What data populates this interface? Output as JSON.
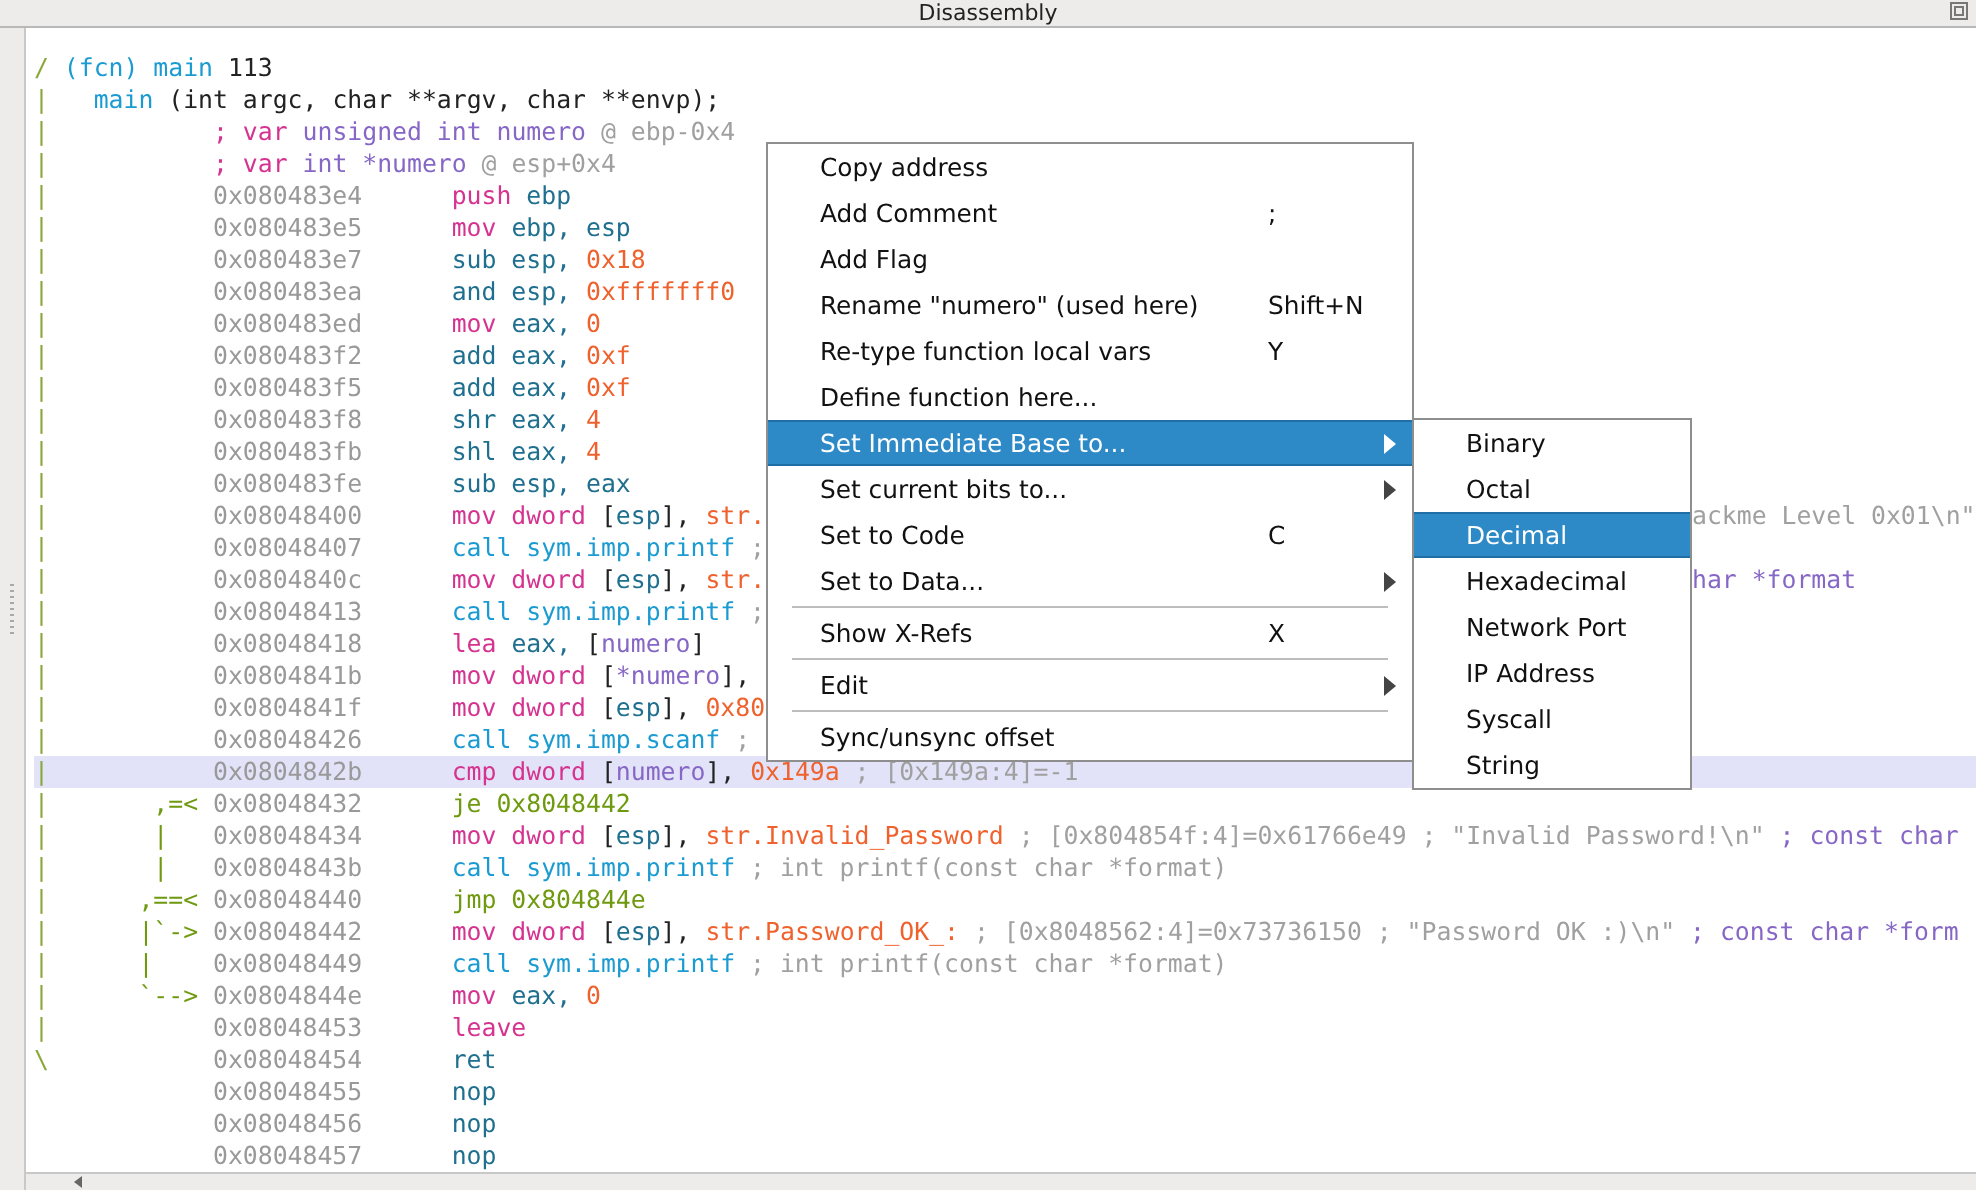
{
  "window": {
    "title": "Disassembly"
  },
  "lines": [
    {
      "kind": "header",
      "gutter": "/",
      "selected": false,
      "segments": [
        {
          "text": "(fcn) main",
          "kind": "call"
        },
        {
          "text": " 113",
          "kind": "plain"
        }
      ]
    },
    {
      "kind": "signature",
      "gutter": "|",
      "selected": false,
      "segments": [
        {
          "text": "main",
          "kind": "call"
        },
        {
          "text": " (int argc, char **argv, char **envp);",
          "kind": "plain"
        }
      ]
    },
    {
      "kind": "var",
      "gutter": "|",
      "selected": false,
      "segments": [
        {
          "text": "; var",
          "kind": "kw"
        },
        {
          "text": " unsigned int numero",
          "kind": "type"
        },
        {
          "text": " @ ebp-0x4",
          "kind": "comment"
        }
      ]
    },
    {
      "kind": "var",
      "gutter": "|",
      "selected": false,
      "segments": [
        {
          "text": "; var",
          "kind": "kw"
        },
        {
          "text": " int *numero",
          "kind": "type"
        },
        {
          "text": " @ esp+0x4",
          "kind": "comment"
        }
      ]
    },
    {
      "kind": "instr",
      "gutter": "|",
      "address": "0x080483e4",
      "selected": false,
      "segments": [
        {
          "text": "push",
          "kind": "kw"
        },
        {
          "text": " ebp",
          "kind": "reg"
        }
      ]
    },
    {
      "kind": "instr",
      "gutter": "|",
      "address": "0x080483e5",
      "selected": false,
      "segments": [
        {
          "text": "mov",
          "kind": "kw"
        },
        {
          "text": " ebp, esp",
          "kind": "reg"
        }
      ]
    },
    {
      "kind": "instr",
      "gutter": "|",
      "address": "0x080483e7",
      "selected": false,
      "segments": [
        {
          "text": "sub esp, ",
          "kind": "reg"
        },
        {
          "text": "0x18",
          "kind": "num"
        }
      ]
    },
    {
      "kind": "instr",
      "gutter": "|",
      "address": "0x080483ea",
      "selected": false,
      "segments": [
        {
          "text": "and esp, ",
          "kind": "reg"
        },
        {
          "text": "0xfffffff0",
          "kind": "num"
        }
      ]
    },
    {
      "kind": "instr",
      "gutter": "|",
      "address": "0x080483ed",
      "selected": false,
      "segments": [
        {
          "text": "mov",
          "kind": "kw"
        },
        {
          "text": " eax, ",
          "kind": "reg"
        },
        {
          "text": "0",
          "kind": "num"
        }
      ]
    },
    {
      "kind": "instr",
      "gutter": "|",
      "address": "0x080483f2",
      "selected": false,
      "segments": [
        {
          "text": "add eax, ",
          "kind": "reg"
        },
        {
          "text": "0xf",
          "kind": "num"
        }
      ]
    },
    {
      "kind": "instr",
      "gutter": "|",
      "address": "0x080483f5",
      "selected": false,
      "segments": [
        {
          "text": "add eax, ",
          "kind": "reg"
        },
        {
          "text": "0xf",
          "kind": "num"
        }
      ]
    },
    {
      "kind": "instr",
      "gutter": "|",
      "address": "0x080483f8",
      "selected": false,
      "segments": [
        {
          "text": "shr eax, ",
          "kind": "reg"
        },
        {
          "text": "4",
          "kind": "num"
        }
      ]
    },
    {
      "kind": "instr",
      "gutter": "|",
      "address": "0x080483fb",
      "selected": false,
      "segments": [
        {
          "text": "shl eax, ",
          "kind": "reg"
        },
        {
          "text": "4",
          "kind": "num"
        }
      ]
    },
    {
      "kind": "instr",
      "gutter": "|",
      "address": "0x080483fe",
      "selected": false,
      "segments": [
        {
          "text": "sub esp, eax",
          "kind": "reg"
        }
      ]
    },
    {
      "kind": "instr",
      "gutter": "|",
      "address": "0x08048400",
      "selected": false,
      "segments": [
        {
          "text": "mov dword",
          "kind": "kw"
        },
        {
          "text": " [",
          "kind": "plain"
        },
        {
          "text": "esp",
          "kind": "reg"
        },
        {
          "text": "], ",
          "kind": "plain"
        },
        {
          "text": "str.",
          "kind": "num"
        }
      ],
      "tail": {
        "text": "ackme Level 0x01\\n\"",
        "kind": "comment"
      }
    },
    {
      "kind": "instr",
      "gutter": "|",
      "address": "0x08048407",
      "selected": false,
      "segments": [
        {
          "text": "call sym.imp.printf",
          "kind": "call"
        },
        {
          "text": " ;",
          "kind": "comment"
        }
      ]
    },
    {
      "kind": "instr",
      "gutter": "|",
      "address": "0x0804840c",
      "selected": false,
      "segments": [
        {
          "text": "mov dword",
          "kind": "kw"
        },
        {
          "text": " [",
          "kind": "plain"
        },
        {
          "text": "esp",
          "kind": "reg"
        },
        {
          "text": "], ",
          "kind": "plain"
        },
        {
          "text": "str.",
          "kind": "num"
        }
      ],
      "tail": {
        "text": "har *format",
        "kind": "type"
      }
    },
    {
      "kind": "instr",
      "gutter": "|",
      "address": "0x08048413",
      "selected": false,
      "segments": [
        {
          "text": "call sym.imp.printf",
          "kind": "call"
        },
        {
          "text": " ;",
          "kind": "comment"
        }
      ]
    },
    {
      "kind": "instr",
      "gutter": "|",
      "address": "0x08048418",
      "selected": false,
      "segments": [
        {
          "text": "lea",
          "kind": "kw"
        },
        {
          "text": " eax, ",
          "kind": "reg"
        },
        {
          "text": "[",
          "kind": "plain"
        },
        {
          "text": "numero",
          "kind": "type"
        },
        {
          "text": "]",
          "kind": "plain"
        }
      ]
    },
    {
      "kind": "instr",
      "gutter": "|",
      "address": "0x0804841b",
      "selected": false,
      "segments": [
        {
          "text": "mov dword",
          "kind": "kw"
        },
        {
          "text": " [",
          "kind": "plain"
        },
        {
          "text": "*numero",
          "kind": "type"
        },
        {
          "text": "],",
          "kind": "plain"
        }
      ]
    },
    {
      "kind": "instr",
      "gutter": "|",
      "address": "0x0804841f",
      "selected": false,
      "segments": [
        {
          "text": "mov dword",
          "kind": "kw"
        },
        {
          "text": " [",
          "kind": "plain"
        },
        {
          "text": "esp",
          "kind": "reg"
        },
        {
          "text": "], ",
          "kind": "plain"
        },
        {
          "text": "0x80",
          "kind": "num"
        }
      ]
    },
    {
      "kind": "instr",
      "gutter": "|",
      "address": "0x08048426",
      "selected": false,
      "segments": [
        {
          "text": "call sym.imp.scanf",
          "kind": "call"
        },
        {
          "text": " ;",
          "kind": "comment"
        }
      ]
    },
    {
      "kind": "instr",
      "gutter": "|",
      "address": "0x0804842b",
      "selected": true,
      "segments": [
        {
          "text": "cmp dword",
          "kind": "kw"
        },
        {
          "text": " [",
          "kind": "plain"
        },
        {
          "text": "numero",
          "kind": "type"
        },
        {
          "text": "], ",
          "kind": "plain"
        },
        {
          "text": "0x149a",
          "kind": "num"
        },
        {
          "text": " ; [0x149a:4]=-1",
          "kind": "comment"
        }
      ]
    },
    {
      "kind": "instr",
      "gutter": "|",
      "flow": ",=<",
      "address": "0x08048432",
      "selected": false,
      "segments": [
        {
          "text": "je 0x8048442",
          "kind": "jump"
        }
      ]
    },
    {
      "kind": "instr",
      "gutter": "|",
      "flow": "|  ",
      "address": "0x08048434",
      "selected": false,
      "segments": [
        {
          "text": "mov dword",
          "kind": "kw"
        },
        {
          "text": " [",
          "kind": "plain"
        },
        {
          "text": "esp",
          "kind": "reg"
        },
        {
          "text": "], ",
          "kind": "plain"
        },
        {
          "text": "str.Invalid_Password",
          "kind": "num"
        },
        {
          "text": " ; [0x804854f:4]=0x61766e49 ; \"Invalid Password!\\n\"",
          "kind": "comment"
        },
        {
          "text": " ; const char",
          "kind": "type"
        }
      ]
    },
    {
      "kind": "instr",
      "gutter": "|",
      "flow": "|  ",
      "address": "0x0804843b",
      "selected": false,
      "segments": [
        {
          "text": "call sym.imp.printf",
          "kind": "call"
        },
        {
          "text": " ; int printf(const char *format)",
          "kind": "comment"
        }
      ]
    },
    {
      "kind": "instr",
      "gutter": "|",
      "flow": ",==<",
      "address": "0x08048440",
      "selected": false,
      "segments": [
        {
          "text": "jmp 0x804844e",
          "kind": "jump"
        }
      ]
    },
    {
      "kind": "instr",
      "gutter": "|",
      "flow": "|`->",
      "address": "0x08048442",
      "selected": false,
      "segments": [
        {
          "text": "mov dword",
          "kind": "kw"
        },
        {
          "text": " [",
          "kind": "plain"
        },
        {
          "text": "esp",
          "kind": "reg"
        },
        {
          "text": "], ",
          "kind": "plain"
        },
        {
          "text": "str.Password_OK_:",
          "kind": "num"
        },
        {
          "text": " ; [0x8048562:4]=0x73736150 ; \"Password OK :)\\n\"",
          "kind": "comment"
        },
        {
          "text": " ; const char *form",
          "kind": "type"
        }
      ]
    },
    {
      "kind": "instr",
      "gutter": "|",
      "flow": "|   ",
      "address": "0x08048449",
      "selected": false,
      "segments": [
        {
          "text": "call sym.imp.printf",
          "kind": "call"
        },
        {
          "text": " ; int printf(const char *format)",
          "kind": "comment"
        }
      ]
    },
    {
      "kind": "instr",
      "gutter": "|",
      "flow": "`-->",
      "address": "0x0804844e",
      "selected": false,
      "segments": [
        {
          "text": "mov",
          "kind": "kw"
        },
        {
          "text": " eax, ",
          "kind": "reg"
        },
        {
          "text": "0",
          "kind": "num"
        }
      ]
    },
    {
      "kind": "instr",
      "gutter": "|",
      "address": "0x08048453",
      "selected": false,
      "segments": [
        {
          "text": "leave",
          "kind": "kw"
        }
      ]
    },
    {
      "kind": "instr",
      "gutter": "\\",
      "address": "0x08048454",
      "selected": false,
      "segments": [
        {
          "text": "ret",
          "kind": "reg"
        }
      ]
    },
    {
      "kind": "instr",
      "address": "0x08048455",
      "selected": false,
      "segments": [
        {
          "text": "nop",
          "kind": "reg"
        }
      ]
    },
    {
      "kind": "instr",
      "address": "0x08048456",
      "selected": false,
      "segments": [
        {
          "text": "nop",
          "kind": "reg"
        }
      ]
    },
    {
      "kind": "instr",
      "address": "0x08048457",
      "selected": false,
      "segments": [
        {
          "text": "nop",
          "kind": "reg"
        }
      ]
    }
  ],
  "context_menu": {
    "items": [
      {
        "label": "Copy address",
        "submenu": false,
        "selected": false,
        "separator_above": false
      },
      {
        "label": "Add Comment",
        "shortcut": ";",
        "submenu": false,
        "selected": false,
        "separator_above": false
      },
      {
        "label": "Add Flag",
        "submenu": false,
        "selected": false,
        "separator_above": false
      },
      {
        "label": "Rename \"numero\" (used here)",
        "shortcut": "Shift+N",
        "submenu": false,
        "selected": false,
        "separator_above": false
      },
      {
        "label": "Re-type function local vars",
        "shortcut": "Y",
        "submenu": false,
        "selected": false,
        "separator_above": false
      },
      {
        "label": "Define function here...",
        "submenu": false,
        "selected": false,
        "separator_above": false
      },
      {
        "label": "Set Immediate Base to...",
        "submenu": true,
        "selected": true,
        "separator_above": false
      },
      {
        "label": "Set current bits to...",
        "submenu": true,
        "selected": false,
        "separator_above": false
      },
      {
        "label": "Set to Code",
        "shortcut": "C",
        "submenu": false,
        "selected": false,
        "separator_above": false
      },
      {
        "label": "Set to Data...",
        "submenu": true,
        "selected": false,
        "separator_above": false
      },
      {
        "label": "Show X-Refs",
        "shortcut": "X",
        "submenu": false,
        "selected": false,
        "separator_above": true
      },
      {
        "label": "Edit",
        "submenu": true,
        "selected": false,
        "separator_above": true
      },
      {
        "label": "Sync/unsync offset",
        "submenu": false,
        "selected": false,
        "separator_above": true
      }
    ],
    "submenu": {
      "items": [
        {
          "label": "Binary",
          "selected": false
        },
        {
          "label": "Octal",
          "selected": false
        },
        {
          "label": "Decimal",
          "selected": true
        },
        {
          "label": "Hexadecimal",
          "selected": false
        },
        {
          "label": "Network Port",
          "selected": false
        },
        {
          "label": "IP Address",
          "selected": false
        },
        {
          "label": "Syscall",
          "selected": false
        },
        {
          "label": "String",
          "selected": false
        }
      ]
    }
  }
}
